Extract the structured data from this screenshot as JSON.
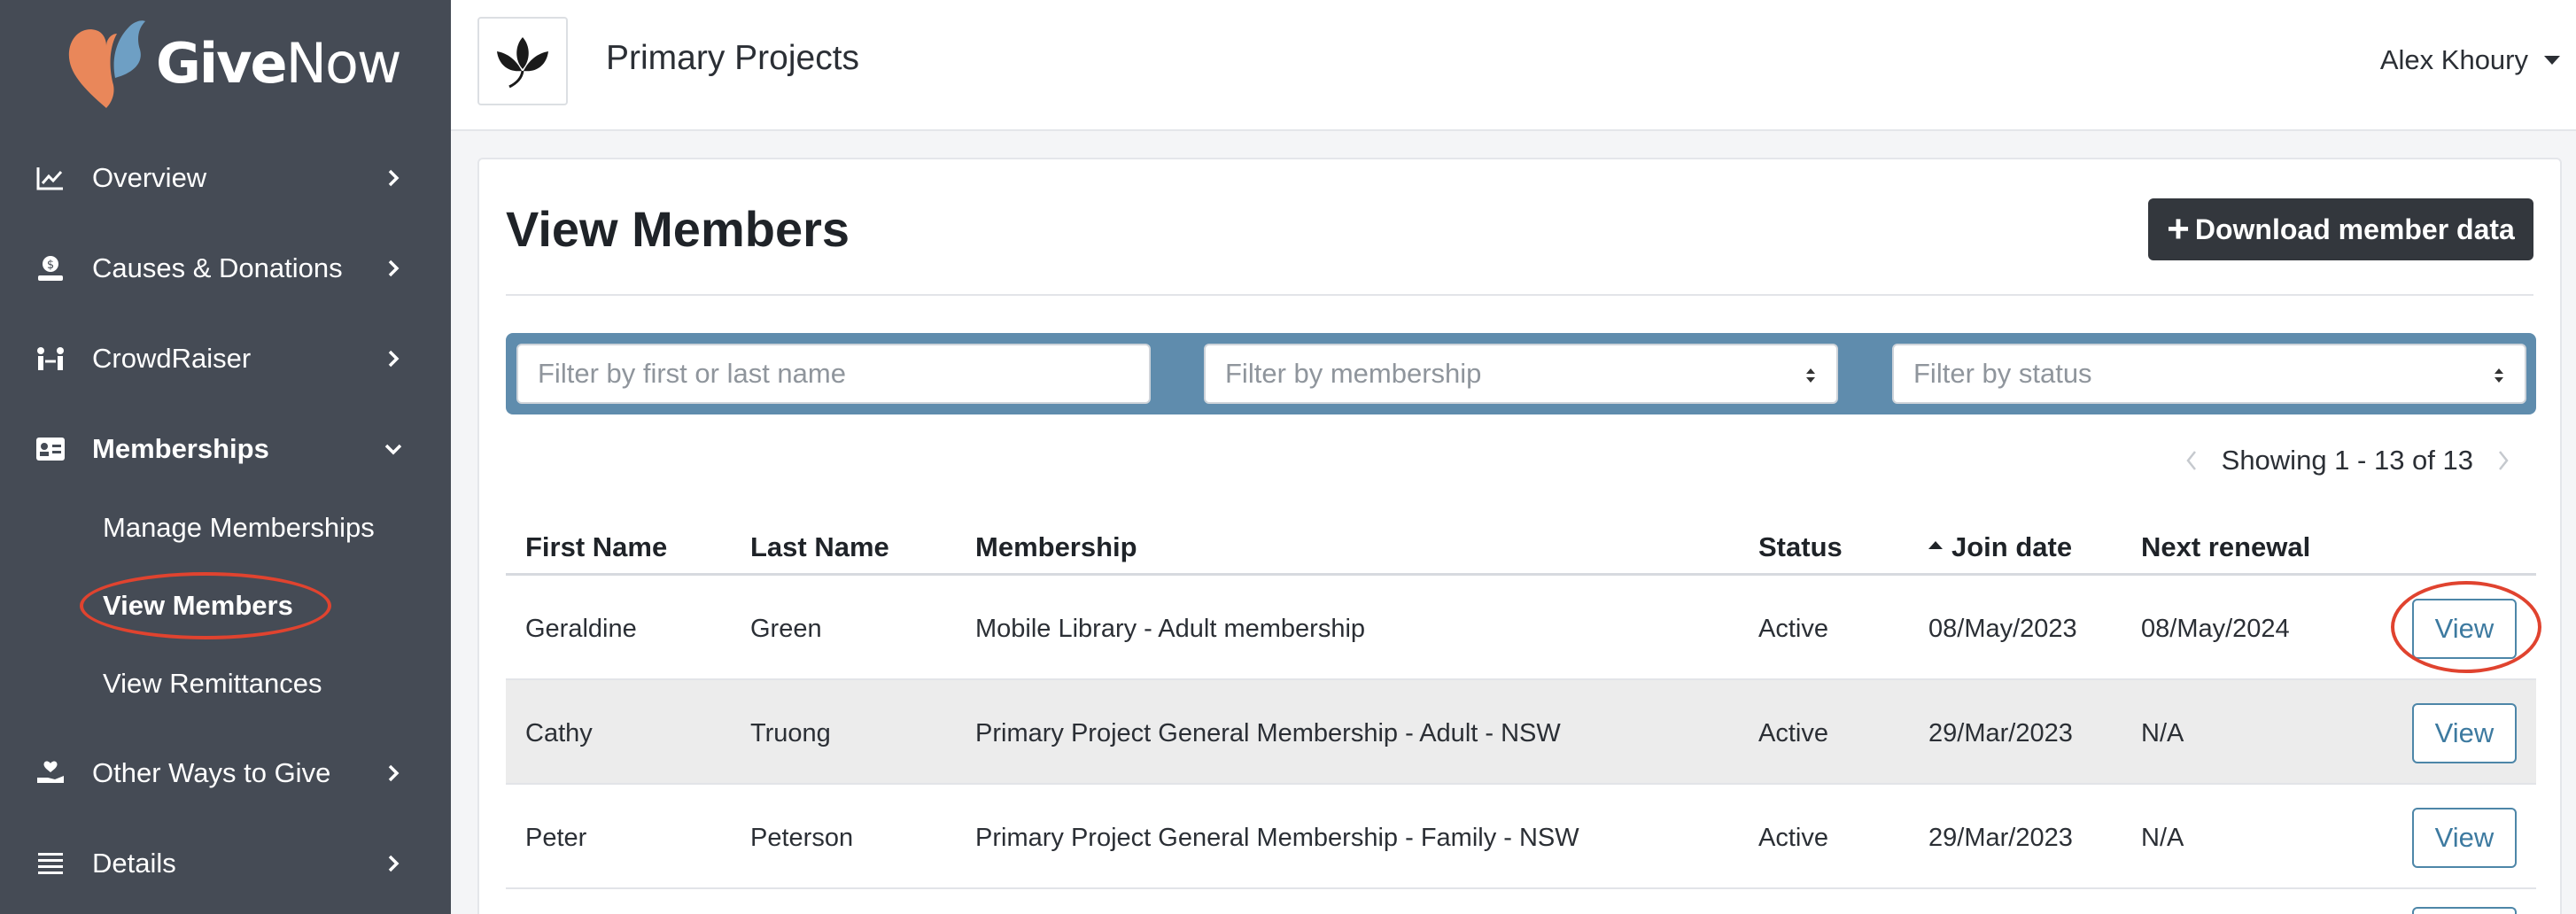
{
  "brand": {
    "name_bold": "Give",
    "name_light": "Now",
    "accent": "#e9875a",
    "accent2": "#5f8cad"
  },
  "header": {
    "org_name": "Primary Projects",
    "user_name": "Alex Khoury"
  },
  "sidebar": {
    "items": [
      {
        "label": "Overview",
        "icon": "chart-line-icon"
      },
      {
        "label": "Causes & Donations",
        "icon": "donation-hand-icon"
      },
      {
        "label": "CrowdRaiser",
        "icon": "people-arrows-icon"
      },
      {
        "label": "Memberships",
        "icon": "id-card-icon"
      },
      {
        "label": "Other Ways to Give",
        "icon": "hand-heart-icon"
      },
      {
        "label": "Details",
        "icon": "list-icon"
      }
    ],
    "sub_items": [
      {
        "label": "Manage Memberships"
      },
      {
        "label": "View Members"
      },
      {
        "label": "View Remittances"
      }
    ]
  },
  "main": {
    "title": "View Members",
    "download_label": "Download member data",
    "filters": {
      "name_placeholder": "Filter by first or last name",
      "membership_placeholder": "Filter by membership",
      "status_placeholder": "Filter by status"
    },
    "pager_text": "Showing 1 - 13 of 13",
    "table": {
      "headers": [
        "First Name",
        "Last Name",
        "Membership",
        "Status",
        "Join date",
        "Next renewal"
      ],
      "view_label": "View",
      "rows": [
        {
          "first": "Geraldine",
          "last": "Green",
          "membership": "Mobile Library - Adult membership",
          "status": "Active",
          "join": "08/May/2023",
          "renewal": "08/May/2024"
        },
        {
          "first": "Cathy",
          "last": "Truong",
          "membership": "Primary Project General Membership - Adult - NSW",
          "status": "Active",
          "join": "29/Mar/2023",
          "renewal": "N/A"
        },
        {
          "first": "Peter",
          "last": "Peterson",
          "membership": "Primary Project General Membership - Family - NSW",
          "status": "Active",
          "join": "29/Mar/2023",
          "renewal": "N/A"
        }
      ]
    }
  }
}
